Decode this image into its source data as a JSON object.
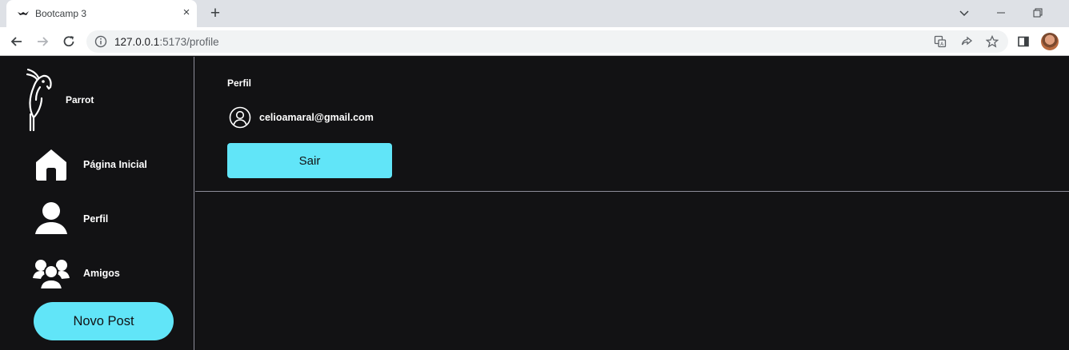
{
  "browser": {
    "tab_title": "Bootcamp 3",
    "tab_close": "×",
    "new_tab": "+",
    "url_host": "127.0.0.1",
    "url_path": ":5173/profile"
  },
  "app": {
    "brand": "Parrot",
    "nav": [
      {
        "label": "Página Inicial",
        "icon": "home-icon"
      },
      {
        "label": "Perfil",
        "icon": "user-icon"
      },
      {
        "label": "Amigos",
        "icon": "users-icon"
      }
    ],
    "new_post_label": "Novo Post",
    "colors": {
      "accent": "#61e5f8",
      "background": "#121214",
      "divider": "#8d8d99"
    }
  },
  "profile": {
    "title": "Perfil",
    "email": "celioamaral@gmail.com",
    "logout_label": "Sair"
  }
}
